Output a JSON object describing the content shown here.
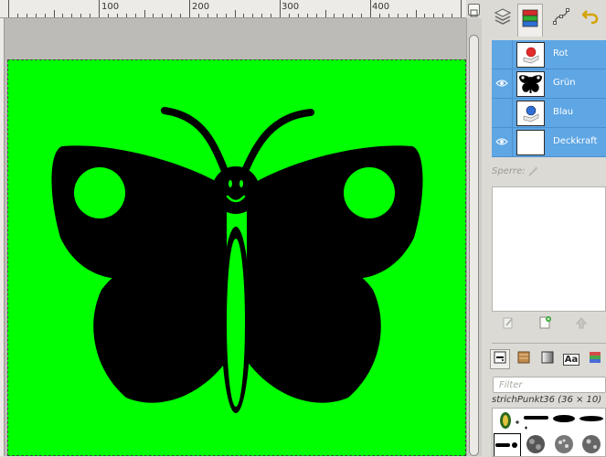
{
  "ruler": {
    "labels": [
      "100",
      "200",
      "300",
      "400"
    ]
  },
  "channels": {
    "items": [
      {
        "name": "Rot",
        "visible": false
      },
      {
        "name": "Grün",
        "visible": true
      },
      {
        "name": "Blau",
        "visible": false
      },
      {
        "name": "Deckkraft",
        "visible": true
      }
    ],
    "lock_label": "Sperre:"
  },
  "brushes": {
    "filter_placeholder": "Filter",
    "selected_name": "strichPunkt36 (36 × 10)",
    "text_tab_label": "Aa"
  },
  "colors": {
    "canvas": "#00ff00",
    "selected_channel": "#5ea6e4"
  }
}
